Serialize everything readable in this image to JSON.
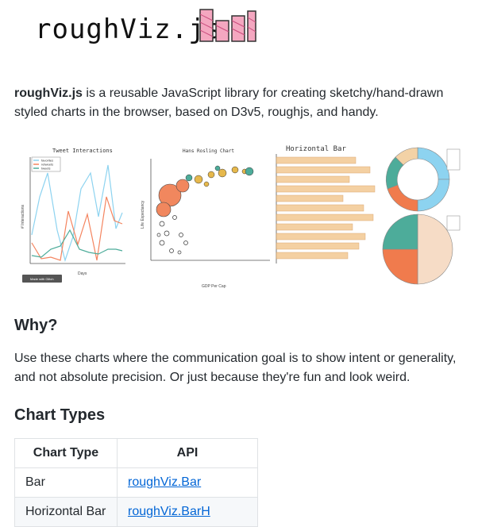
{
  "logo": {
    "text": "roughViz.js"
  },
  "intro": {
    "lib_name": "roughViz.js",
    "description": " is a reusable JavaScript library for creating sketchy/hand-drawn styled charts in the browser, based on D3v5, roughjs, and handy."
  },
  "gallery": {
    "chart1_title": "Tweet Interactions",
    "chart1_xlabel": "Days",
    "chart1_ylabel": "# Interactions",
    "chart1_legend": [
      "favorites",
      "retweets",
      "tweets"
    ],
    "chart1_badge": "Made with Glitch",
    "chart2_title": "Hans Rosling Chart",
    "chart2_xlabel": "GDP Per Cap",
    "chart2_ylabel": "Life Expectancy",
    "chart3_title": "Horizontal Bar"
  },
  "why": {
    "heading": "Why?",
    "text": "Use these charts where the communication goal is to show intent or generality, and not absolute precision. Or just because they're fun and look weird."
  },
  "chart_types": {
    "heading": "Chart Types",
    "headers": [
      "Chart Type",
      "API"
    ],
    "rows": [
      {
        "type": "Bar",
        "api": "roughViz.Bar"
      },
      {
        "type": "Horizontal Bar",
        "api": "roughViz.BarH"
      }
    ]
  },
  "colors": {
    "link": "#0366d6",
    "text": "#24292e",
    "border": "#dfe2e5",
    "logo_pink": "#f4a7c0"
  }
}
